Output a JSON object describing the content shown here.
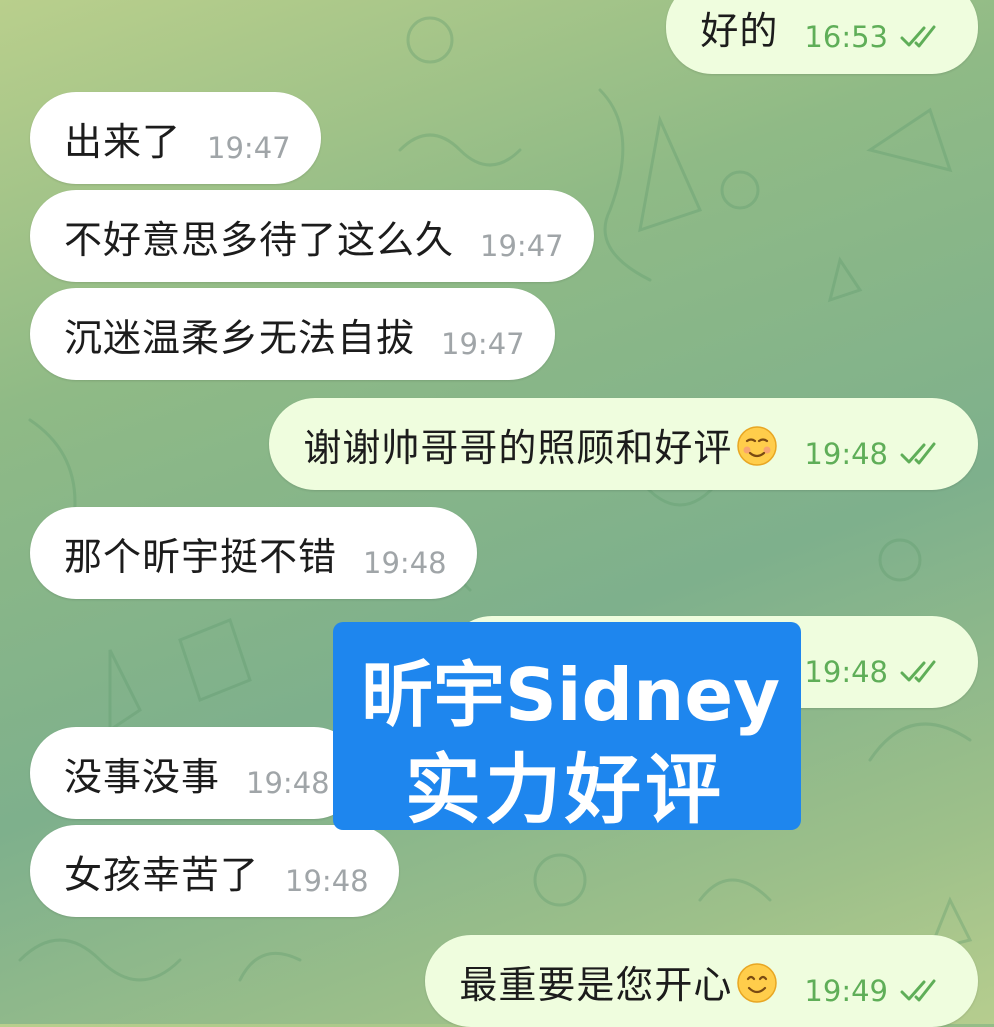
{
  "messages": [
    {
      "direction": "out",
      "text": "好的",
      "time": "16:53",
      "read": true
    },
    {
      "direction": "in",
      "text": "出来了",
      "time": "19:47"
    },
    {
      "direction": "in",
      "text": "不好意思多待了这么久",
      "time": "19:47"
    },
    {
      "direction": "in",
      "text": "沉迷温柔乡无法自拔",
      "time": "19:47"
    },
    {
      "direction": "out",
      "text": "谢谢帅哥哥的照顾和好评",
      "emoji": "smiling-face-icon",
      "time": "19:48",
      "read": true
    },
    {
      "direction": "in",
      "text": "那个昕宇挺不错",
      "time": "19:48"
    },
    {
      "direction": "out",
      "text": "",
      "time": "19:48",
      "read": true
    },
    {
      "direction": "in",
      "text": "没事没事",
      "time": "19:48"
    },
    {
      "direction": "in",
      "text": "女孩幸苦了",
      "time": "19:48"
    },
    {
      "direction": "out",
      "text": "最重要是您开心",
      "emoji": "smiling-face-icon",
      "time": "19:49",
      "read": true
    }
  ],
  "overlay": {
    "line1": "昕宇Sidney",
    "line2": "实力好评",
    "color": "#1e86ee"
  },
  "colors": {
    "incoming": "#ffffff",
    "outgoing": "#effdde",
    "tick": "#5fae58",
    "time_in": "#a0a5a8"
  }
}
